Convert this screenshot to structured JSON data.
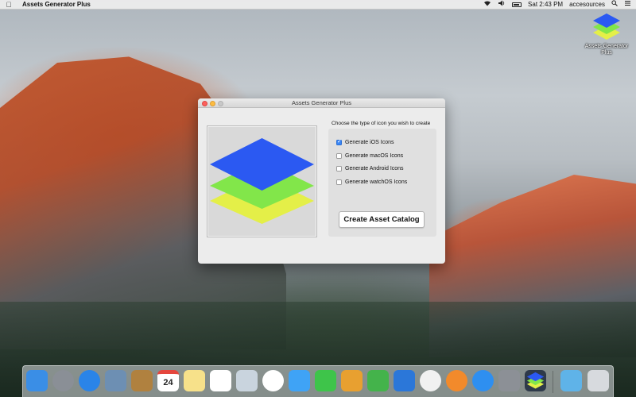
{
  "menubar": {
    "app_name": "Assets Generator Plus",
    "clock": "Sat 2:43 PM",
    "user": "accesources"
  },
  "desktop_icon": {
    "label": "Assets Generator Plus"
  },
  "window": {
    "title": "Assets Generator Plus",
    "prompt": "Choose the type of icon you wish to create",
    "options": [
      {
        "label": "Generate iOS Icons",
        "checked": true
      },
      {
        "label": "Generate macOS Icons",
        "checked": false
      },
      {
        "label": "Generate Android Icons",
        "checked": false
      },
      {
        "label": "Generate watchOS Icons",
        "checked": false
      }
    ],
    "create_button": "Create Asset Catalog"
  },
  "layer_colors": {
    "top": "#2b59f2",
    "middle": "#82e64a",
    "bottom": "#e4ef48"
  },
  "dock": {
    "apps": [
      {
        "name": "finder-icon",
        "color": "#3a8ee6"
      },
      {
        "name": "launchpad-icon",
        "color": "#8a8f96"
      },
      {
        "name": "safari-icon",
        "color": "#2a84e8"
      },
      {
        "name": "mail-photo-icon",
        "color": "#6d8fb3"
      },
      {
        "name": "contacts-icon",
        "color": "#b0813f"
      },
      {
        "name": "calendar-icon",
        "color": "#ffffff"
      },
      {
        "name": "notes-icon",
        "color": "#f7e18a"
      },
      {
        "name": "reminders-icon",
        "color": "#ffffff"
      },
      {
        "name": "photo-booth-icon",
        "color": "#c9d4de"
      },
      {
        "name": "photos-icon",
        "color": "#ffffff"
      },
      {
        "name": "messages-icon",
        "color": "#3fa3f6"
      },
      {
        "name": "facetime-icon",
        "color": "#3ec44a"
      },
      {
        "name": "pages-icon",
        "color": "#e8a030"
      },
      {
        "name": "numbers-icon",
        "color": "#44b34b"
      },
      {
        "name": "keynote-icon",
        "color": "#2b77d9"
      },
      {
        "name": "itunes-icon",
        "color": "#f1f1f1"
      },
      {
        "name": "ibooks-icon",
        "color": "#f28a2b"
      },
      {
        "name": "app-store-icon",
        "color": "#2e8ff0"
      },
      {
        "name": "system-preferences-icon",
        "color": "#8c9096"
      },
      {
        "name": "assets-generator-icon",
        "color": "#2e3a4a"
      },
      {
        "name": "downloads-folder-icon",
        "color": "#5fb3e8"
      },
      {
        "name": "trash-icon",
        "color": "#d7dade"
      }
    ],
    "calendar_day": "24"
  }
}
